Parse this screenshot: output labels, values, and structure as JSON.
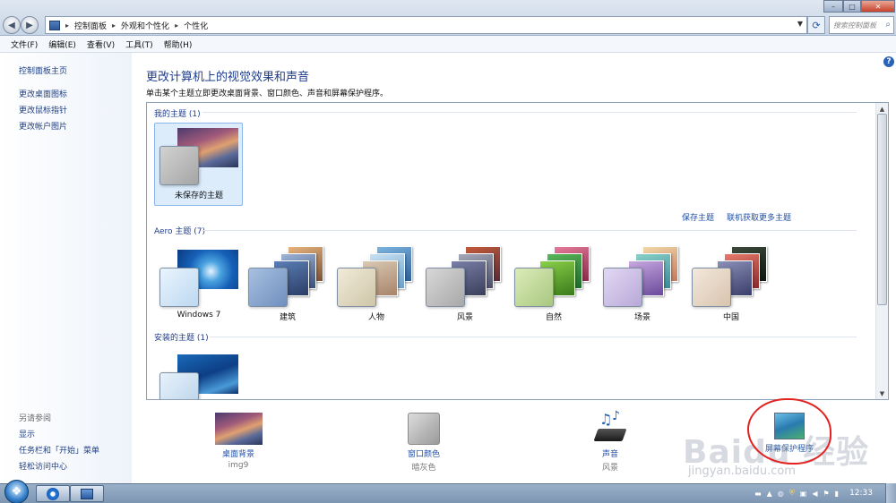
{
  "window": {
    "breadcrumb": [
      "控制面板",
      "外观和个性化",
      "个性化"
    ],
    "search_placeholder": "搜索控制面板"
  },
  "menubar": {
    "items": [
      "文件(F)",
      "编辑(E)",
      "查看(V)",
      "工具(T)",
      "帮助(H)"
    ]
  },
  "sidebar": {
    "links": [
      "控制面板主页",
      "更改桌面图标",
      "更改鼠标指针",
      "更改帐户图片"
    ],
    "see_also_heading": "另请参阅",
    "see_also_links": [
      "显示",
      "任务栏和「开始」菜单",
      "轻松访问中心"
    ]
  },
  "main": {
    "title": "更改计算机上的视觉效果和声音",
    "description": "单击某个主题立即更改桌面背景、窗口颜色、声音和屏幕保护程序。"
  },
  "themes": {
    "my_group": {
      "header": "我的主题 (1)",
      "items": [
        {
          "name": "未保存的主题"
        }
      ]
    },
    "save_theme_link": "保存主题",
    "get_more_link": "联机获取更多主题",
    "aero_group": {
      "header": "Aero 主题 (7)",
      "items": [
        {
          "name": "Windows 7"
        },
        {
          "name": "建筑"
        },
        {
          "name": "人物"
        },
        {
          "name": "风景"
        },
        {
          "name": "自然"
        },
        {
          "name": "场景"
        },
        {
          "name": "中国"
        }
      ]
    },
    "installed_group": {
      "header": "安装的主题 (1)"
    }
  },
  "bottom": {
    "desktop_bg": {
      "label": "桌面背景",
      "value": "img9"
    },
    "window_color": {
      "label": "窗口颜色",
      "value": "暗灰色"
    },
    "sounds": {
      "label": "声音",
      "value": "风景"
    },
    "screensaver": {
      "label": "屏幕保护程序"
    }
  },
  "watermark": {
    "brand": "Baidu 经验",
    "url": "jingyan.baidu.com"
  },
  "taskbar": {
    "clock": "12:33"
  }
}
